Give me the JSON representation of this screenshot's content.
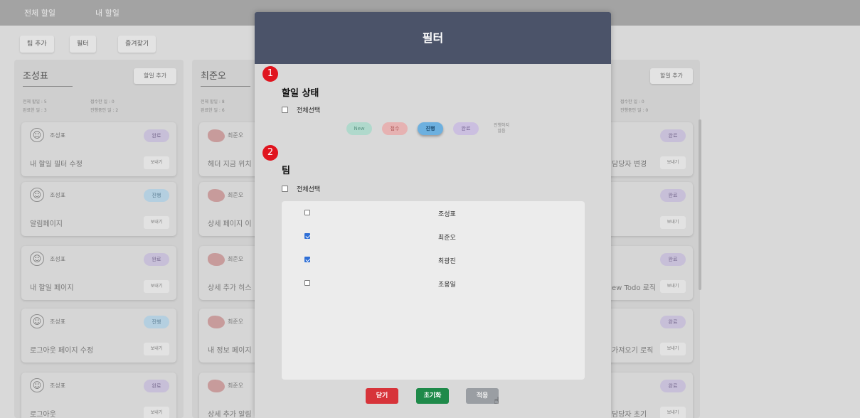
{
  "nav": {
    "tabs": [
      "전체 할일",
      "내 할일"
    ]
  },
  "toolbar": {
    "add_team": "팀 추가",
    "filter": "필터",
    "favorites": "즐겨찾기"
  },
  "left_column": {
    "name": "조성표",
    "add_label": "할일 추가",
    "stats": [
      "전체 할일 : 5",
      "접수한 일 : 0",
      "완료한 일 : 3",
      "진행중인 일 : 2"
    ],
    "cards": [
      {
        "user": "조성표",
        "status": "완료",
        "title": "내 할일 필터 수정",
        "send": "보내기"
      },
      {
        "user": "조성표",
        "status": "진행",
        "title": "알림페이지",
        "send": "보내기"
      },
      {
        "user": "조성표",
        "status": "완료",
        "title": "내 할일 페이지",
        "send": "보내기"
      },
      {
        "user": "조성표",
        "status": "진행",
        "title": "로그아웃 페이지 수정",
        "send": "보내기"
      },
      {
        "user": "조성표",
        "status": "완료",
        "title": "로그아웃",
        "send": "보내기"
      }
    ]
  },
  "middle_column": {
    "name": "최준오",
    "stats": [
      "전체 할일 : 8",
      "완료한 일 : 6"
    ],
    "cards": [
      {
        "user": "최준오",
        "title": "헤더 지금 위치"
      },
      {
        "user": "최준오",
        "title": "상세 페이지 이"
      },
      {
        "user": "최준오",
        "title": "상세 추가 히스"
      },
      {
        "user": "최준오",
        "title": "내 정보 페이지"
      },
      {
        "user": "최준오",
        "title": "상세 추가 알림"
      }
    ]
  },
  "right_column": {
    "add_label": "할일 추가",
    "stats": [
      "접수한 일 : 0",
      "진행중인 일 : 0"
    ],
    "cards": [
      {
        "status": "완료",
        "title": "담당자 변경",
        "send": "보내기"
      },
      {
        "status": "완료",
        "title": "",
        "send": "보내기"
      },
      {
        "status": "완료",
        "title": "ew Todo 로직",
        "send": "보내기"
      },
      {
        "status": "완료",
        "title": "가져오기 로직",
        "send": "보내기"
      },
      {
        "status": "완료",
        "title": "담당자 초기",
        "send": "보내기"
      }
    ]
  },
  "modal": {
    "title": "필터",
    "marker1": "1",
    "marker2": "2",
    "status_section": {
      "title": "할일 상태",
      "select_all": "전체선택",
      "chips": [
        "New",
        "접수",
        "진행",
        "완료",
        "진행하지\n않음"
      ]
    },
    "team_section": {
      "title": "팀",
      "select_all": "전체선택",
      "members": [
        {
          "name": "조성표",
          "checked": false
        },
        {
          "name": "최준오",
          "checked": true
        },
        {
          "name": "최광진",
          "checked": true
        },
        {
          "name": "조용일",
          "checked": false
        }
      ]
    },
    "buttons": {
      "close": "닫기",
      "reset": "초기화",
      "apply": "적용"
    }
  }
}
